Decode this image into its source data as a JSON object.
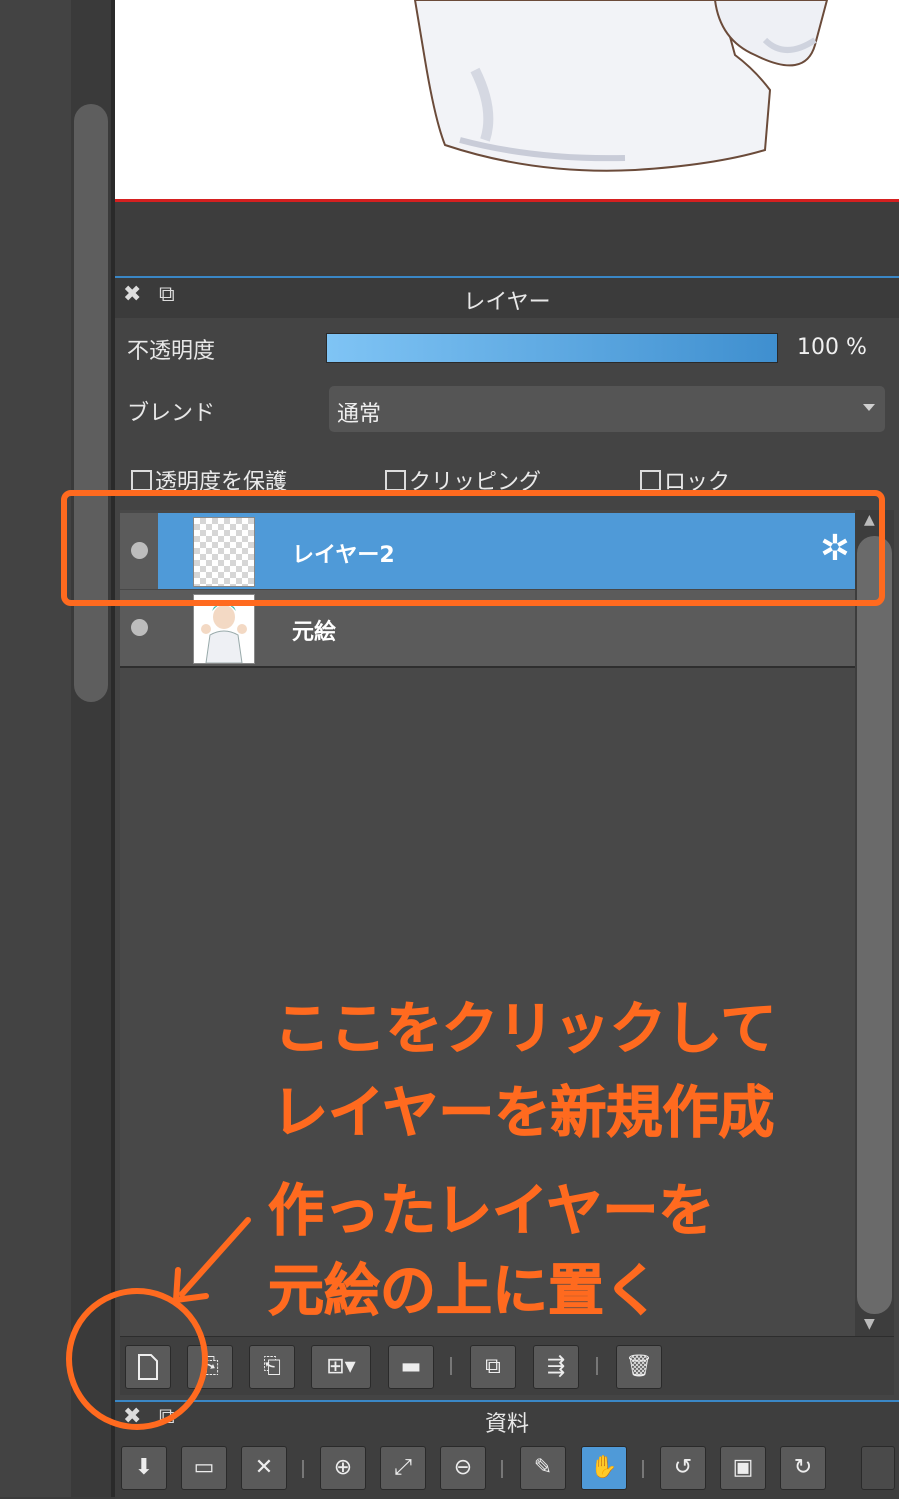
{
  "layer_panel": {
    "title": "レイヤー",
    "opacity_label": "不透明度",
    "opacity_value": "100 %",
    "opacity_level": 1.0,
    "blend_label": "ブレンド",
    "blend_value": "通常",
    "checkboxes": [
      {
        "label": "透明度を保護",
        "checked": false
      },
      {
        "label": "クリッピング",
        "checked": false
      },
      {
        "label": "ロック",
        "checked": false
      }
    ],
    "layers": [
      {
        "name": "レイヤー2",
        "selected": true,
        "thumbnail": "transparent"
      },
      {
        "name": "元絵",
        "selected": false,
        "thumbnail": "illustration"
      }
    ]
  },
  "toolbar": {
    "buttons": [
      "new-layer-icon",
      "new-8bit-layer-icon",
      "new-1bit-layer-icon",
      "add-layer-menu-icon",
      "new-folder-icon",
      "duplicate-layer-icon",
      "merge-down-icon",
      "delete-layer-icon"
    ]
  },
  "ref_panel": {
    "title": "資料",
    "buttons": [
      "download-icon",
      "open-folder-icon",
      "close-icon",
      "zoom-in-icon",
      "fit-icon",
      "zoom-out-icon",
      "eyedropper-icon",
      "hand-icon",
      "rotate-left-icon",
      "fit-screen-icon",
      "rotate-right-icon"
    ]
  },
  "annotations": {
    "instruction_line1": "ここをクリックして",
    "instruction_line2": "レイヤーを新規作成",
    "note_line1": "作ったレイヤーを",
    "note_line2": "元絵の上に置く"
  },
  "colors": {
    "accent": "#3a87c6",
    "selection": "#4f9ad8",
    "annotation": "#ff6a1f"
  }
}
